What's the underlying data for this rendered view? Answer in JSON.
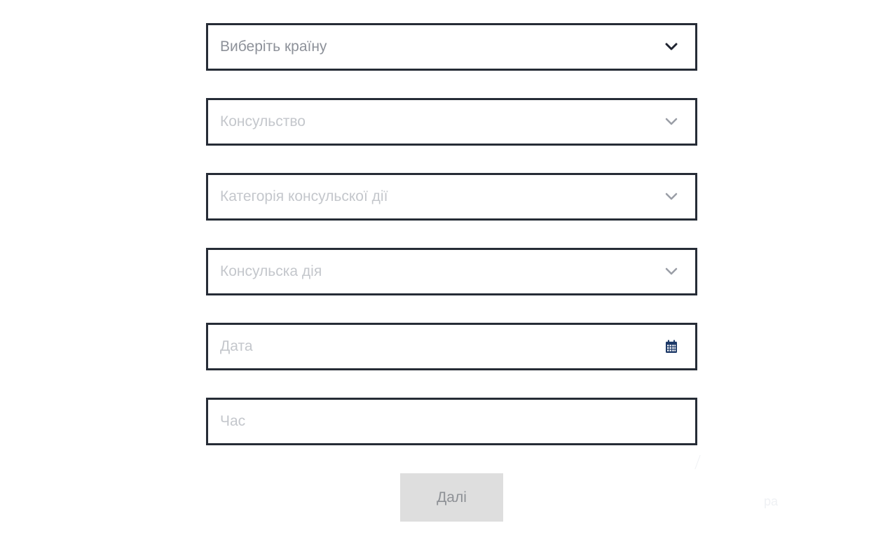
{
  "form": {
    "country": {
      "placeholder": "Виберіть країну",
      "icon": "chevron-down-icon"
    },
    "consulate": {
      "placeholder": "Консульство",
      "icon": "chevron-down-icon"
    },
    "category": {
      "placeholder": "Категорія консульскої дії",
      "icon": "chevron-down-icon"
    },
    "action": {
      "placeholder": "Консульска дія",
      "icon": "chevron-down-icon"
    },
    "date": {
      "placeholder": "Дата",
      "icon": "calendar-icon"
    },
    "time": {
      "placeholder": "Час"
    },
    "next_label": "Далі"
  },
  "colors": {
    "border": "#262c36",
    "placeholder_active": "#8d9199",
    "placeholder_disabled": "#c4c7cc",
    "chevron_active": "#1f2430",
    "chevron_disabled": "#9a9ea6",
    "calendar_icon": "#1e3a68",
    "button_bg": "#dedede",
    "button_text": "#8e9196"
  },
  "background": {
    "faint_text": "ра"
  }
}
